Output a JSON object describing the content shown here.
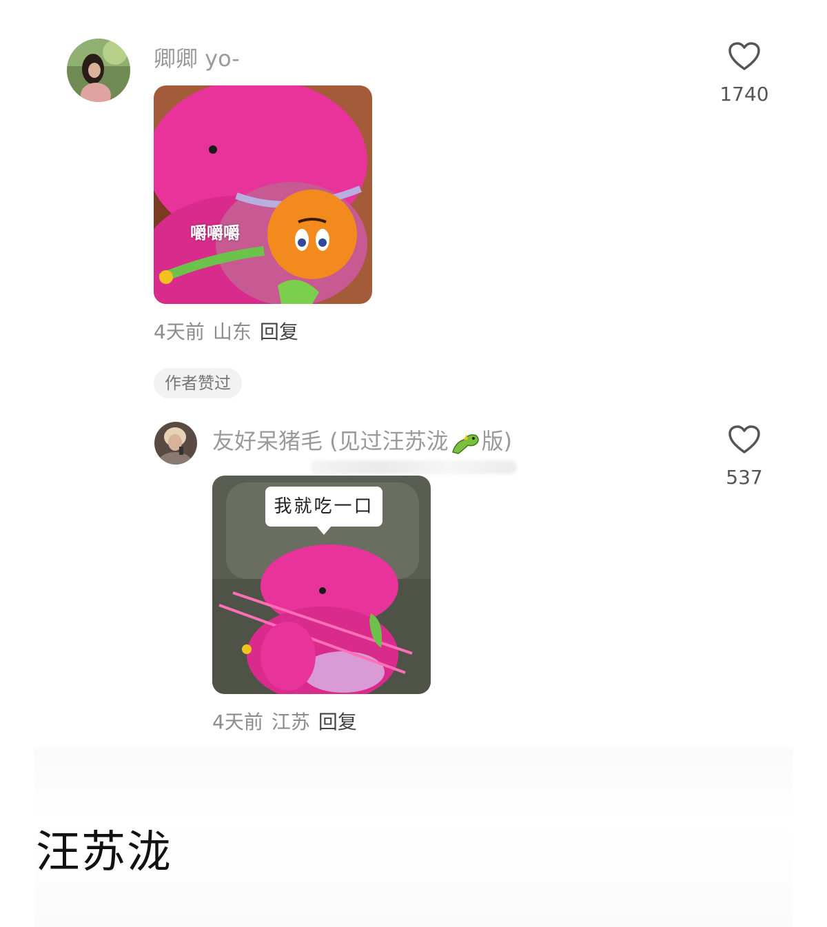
{
  "comments": [
    {
      "username": "卿卿 yo-",
      "likes": "1740",
      "sticker_caption": "嚼嚼嚼",
      "time": "4天前",
      "location": "山东",
      "reply_label": "回复"
    },
    {
      "username": "友好呆猪毛 (见过汪苏泷",
      "username_suffix": "版)",
      "likes": "537",
      "sticker_caption": "我就吃一口",
      "time": "4天前",
      "location": "江苏",
      "reply_label": "回复"
    }
  ],
  "author_liked_badge": "作者赞过",
  "post_title": "汪苏泷",
  "colors": {
    "dino_pink": "#e8339a",
    "orange": "#f28a1e",
    "sofa": "#5a5e52"
  }
}
